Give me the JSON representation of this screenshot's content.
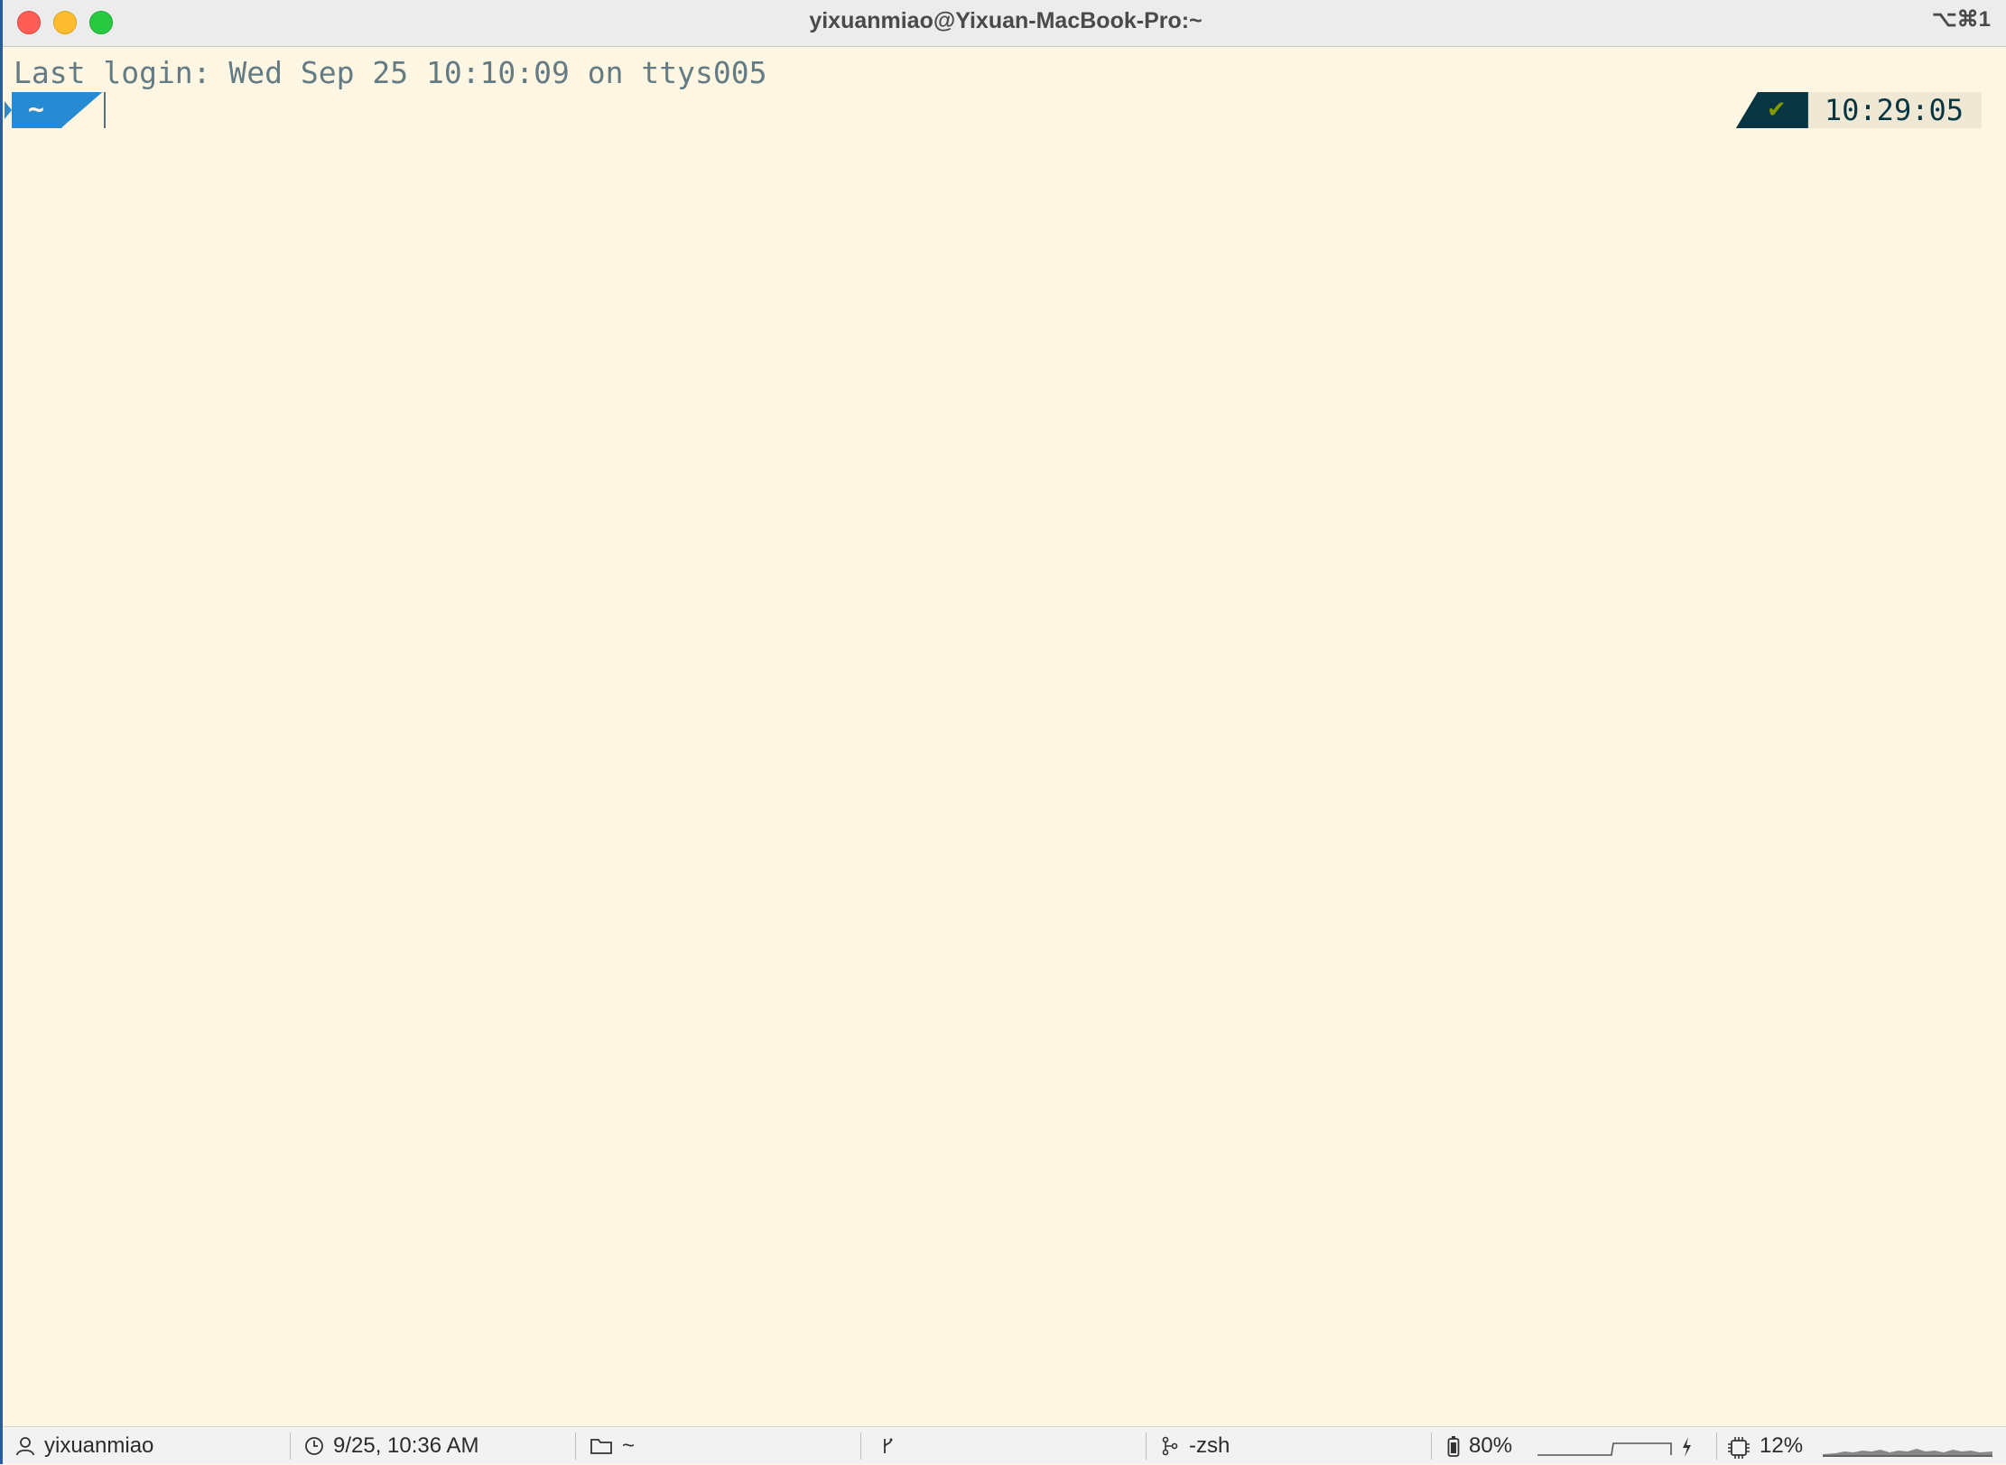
{
  "window": {
    "title": "yixuanmiao@Yixuan-MacBook-Pro:~",
    "shortcut": "⌥⌘1"
  },
  "terminal": {
    "login_line": "Last login: Wed Sep 25 10:10:09 on ttys005",
    "prompt_dir": "~",
    "status_symbol": "✔",
    "right_time": "10:29:05"
  },
  "statusbar": {
    "user": "yixuanmiao",
    "datetime": "9/25, 10:36 AM",
    "directory": "~",
    "git_branch": "",
    "job": "-zsh",
    "battery": "80%",
    "cpu": "12%"
  },
  "colors": {
    "background": "#fdf6e3",
    "prompt_blue": "#268bd2",
    "status_dark": "#073642",
    "ok_green": "#859900"
  },
  "icons": [
    "close-icon",
    "minimize-icon",
    "maximize-icon",
    "user-icon",
    "clock-icon",
    "folder-icon",
    "git-branch-icon",
    "process-icon",
    "battery-icon",
    "charging-icon",
    "cpu-icon"
  ]
}
